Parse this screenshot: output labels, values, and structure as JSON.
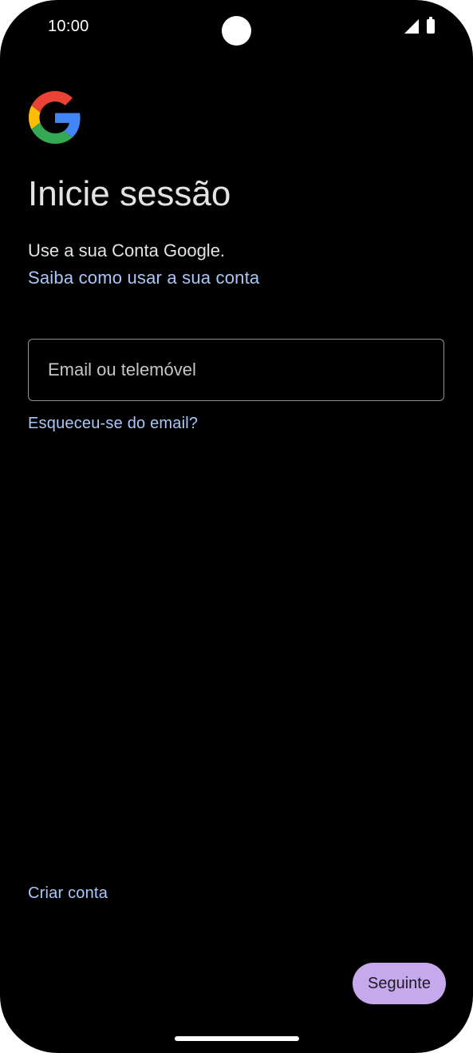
{
  "status_bar": {
    "time": "10:00",
    "icons": [
      "signal-icon",
      "battery-icon"
    ]
  },
  "logo": {
    "icon": "google-g-logo-icon",
    "colors": [
      "#EA4335",
      "#FBBC05",
      "#34A853",
      "#4285F4"
    ]
  },
  "signin": {
    "title": "Inicie sessão",
    "subtitle": "Use a sua Conta Google.",
    "learn_link": "Saiba como usar a sua conta",
    "email_placeholder": "Email ou telemóvel",
    "email_value": "",
    "forgot_link": "Esqueceu-se do email?",
    "create_account": "Criar conta",
    "next_button": "Seguinte"
  },
  "colors": {
    "background": "#000000",
    "text": "#e3e3e3",
    "link": "#a8c7fa",
    "button_bg": "#c6a8ec",
    "button_text": "#1d1b20"
  }
}
